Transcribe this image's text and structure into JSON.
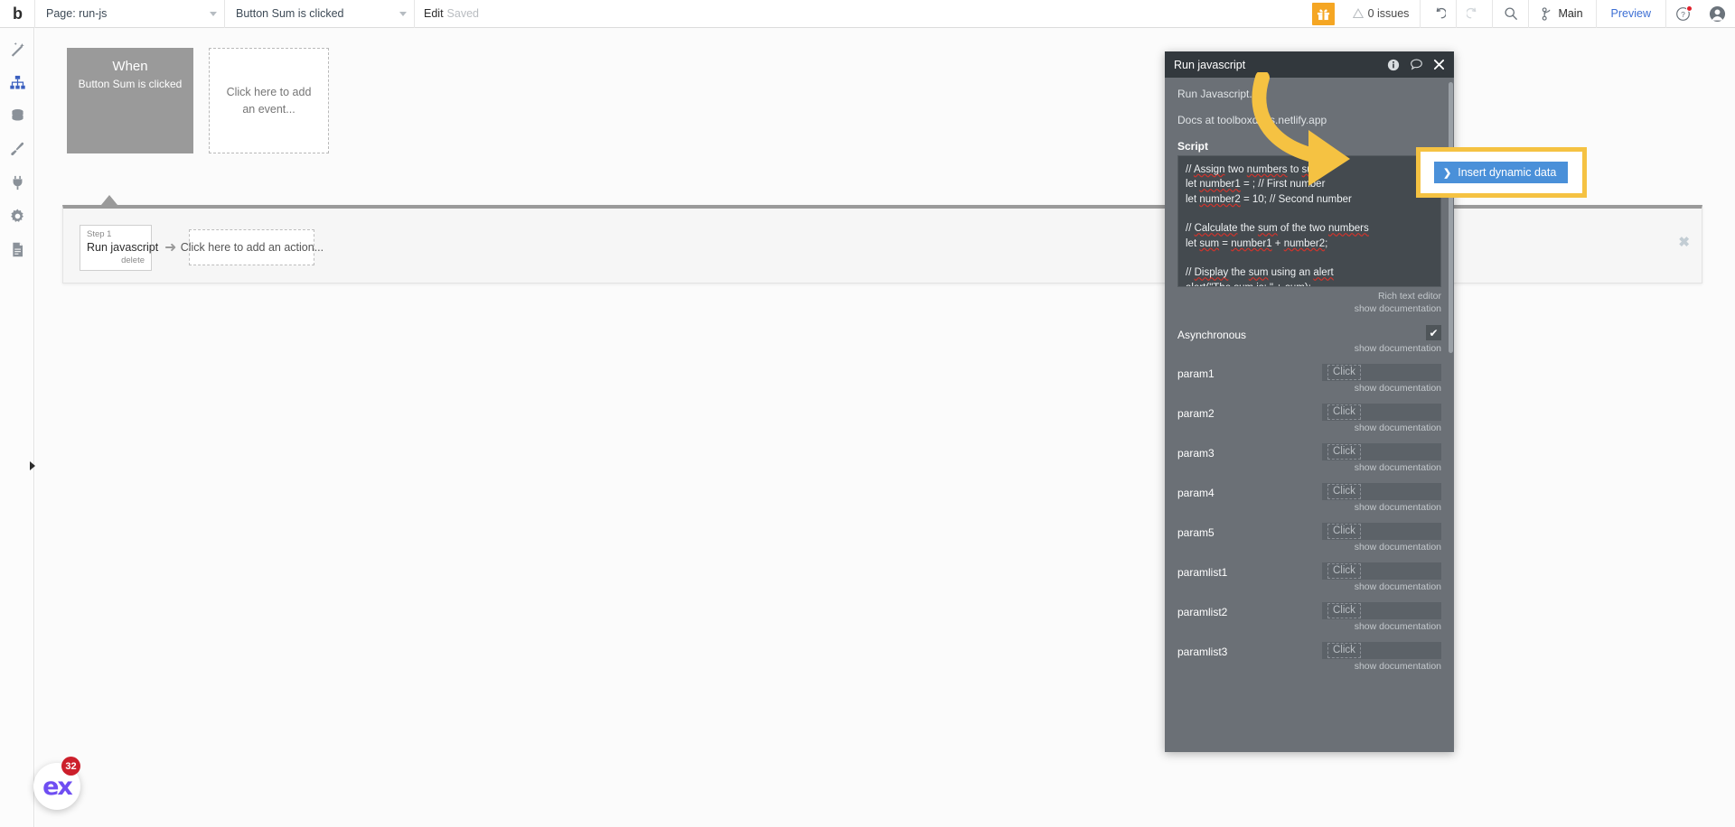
{
  "topbar": {
    "logo": "b",
    "page_select": {
      "value": "Page: run-js",
      "icon": "chevron-down-icon"
    },
    "event_select": {
      "value": "Button Sum is clicked",
      "icon": "chevron-down-icon"
    },
    "edit_label": "Edit",
    "saved_label": "Saved",
    "gift_icon": "gift-icon",
    "issues_label": "0 issues",
    "issues_icon": "warning-triangle-icon",
    "undo_icon": "undo-icon",
    "redo_icon": "redo-icon",
    "search_icon": "search-icon",
    "branch_icon": "branch-icon",
    "branch_label": "Main",
    "preview_label": "Preview",
    "help_icon": "help-circle-icon",
    "avatar_icon": "user-avatar-icon"
  },
  "sidebar": {
    "items": [
      {
        "name": "design",
        "icon": "wand-icon",
        "active": false
      },
      {
        "name": "workflow",
        "icon": "org-chart-icon",
        "active": true
      },
      {
        "name": "data",
        "icon": "database-icon",
        "active": false
      },
      {
        "name": "styles",
        "icon": "paintbrush-icon",
        "active": false
      },
      {
        "name": "plugins",
        "icon": "plug-icon",
        "active": false
      },
      {
        "name": "settings",
        "icon": "gear-icon",
        "active": false
      },
      {
        "name": "logs",
        "icon": "document-icon",
        "active": false
      }
    ],
    "collapse_icon": "triangle-right-icon"
  },
  "canvas": {
    "event": {
      "title": "When",
      "subtitle": "Button Sum is clicked"
    },
    "add_event_placeholder": "Click here to add an event...",
    "step": {
      "number_label": "Step 1",
      "name": "Run javascript",
      "delete_label": "delete"
    },
    "step_arrow_icon": "arrow-right-icon",
    "add_action_placeholder": "Click here to add an action...",
    "close_icon": "close-icon"
  },
  "panel": {
    "title": "Run javascript",
    "info_icon": "info-circle-icon",
    "comment_icon": "comment-bubble-icon",
    "close_icon": "close-icon",
    "description_line1": "Run Javascript.",
    "description_line2": "Docs at toolboxdocs.netlify.app",
    "script_label": "Script",
    "script_lines": [
      "// Assign two numbers to sum",
      "let number1 = ; // First number",
      "let number2 = 10; // Second number",
      "",
      "// Calculate the sum of the two numbers",
      "let sum = number1 + number2;",
      "",
      "// Display the sum using an alert",
      "alert(\"The sum is: \" + sum);"
    ],
    "rich_text_editor_label": "Rich text editor",
    "show_documentation_label": "show documentation",
    "asynchronous": {
      "label": "Asynchronous",
      "checked": true,
      "check_icon": "checkmark-icon"
    },
    "params": [
      {
        "label": "param1",
        "value": "",
        "placeholder": "Click"
      },
      {
        "label": "param2",
        "value": "",
        "placeholder": "Click"
      },
      {
        "label": "param3",
        "value": "",
        "placeholder": "Click"
      },
      {
        "label": "param4",
        "value": "",
        "placeholder": "Click"
      },
      {
        "label": "param5",
        "value": "",
        "placeholder": "Click"
      },
      {
        "label": "paramlist1",
        "value": "",
        "placeholder": "Click"
      },
      {
        "label": "paramlist2",
        "value": "",
        "placeholder": "Click"
      },
      {
        "label": "paramlist3",
        "value": "",
        "placeholder": "Click"
      }
    ]
  },
  "highlight": {
    "insert_dynamic_data_label": "Insert dynamic data",
    "chevron_icon": "chevron-right-icon",
    "box_color": "#f5c242",
    "button_color": "#4a90d9",
    "arrow_color": "#f5c242"
  },
  "chat": {
    "logo_text": "ex",
    "badge_count": "32",
    "badge_color": "#cc1f2b"
  }
}
